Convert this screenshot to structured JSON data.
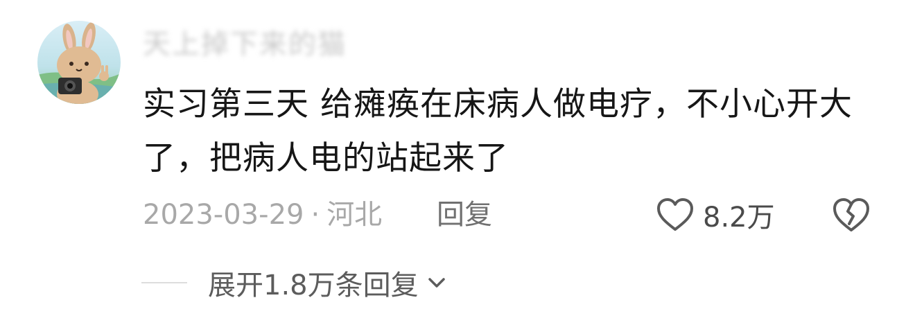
{
  "comment": {
    "username": "天上掉下来的猫",
    "text": "实习第三天 给瘫痪在床病人做电疗，不小心开大了，把病人电的站起来了",
    "date": "2023-03-29",
    "separator": "·",
    "location": "河北",
    "reply_label": "回复",
    "like_count": "8.2万",
    "expand_label": "展开1.8万条回复"
  },
  "icons": {
    "avatar": "bunny-with-camera-avatar",
    "like": "heart-outline-icon",
    "dislike": "broken-heart-icon",
    "expand": "chevron-down-icon"
  },
  "colors": {
    "text_primary": "#161616",
    "text_meta": "#a8a8a8",
    "text_secondary": "#5c5c5c",
    "icon": "#5a5a5a"
  }
}
